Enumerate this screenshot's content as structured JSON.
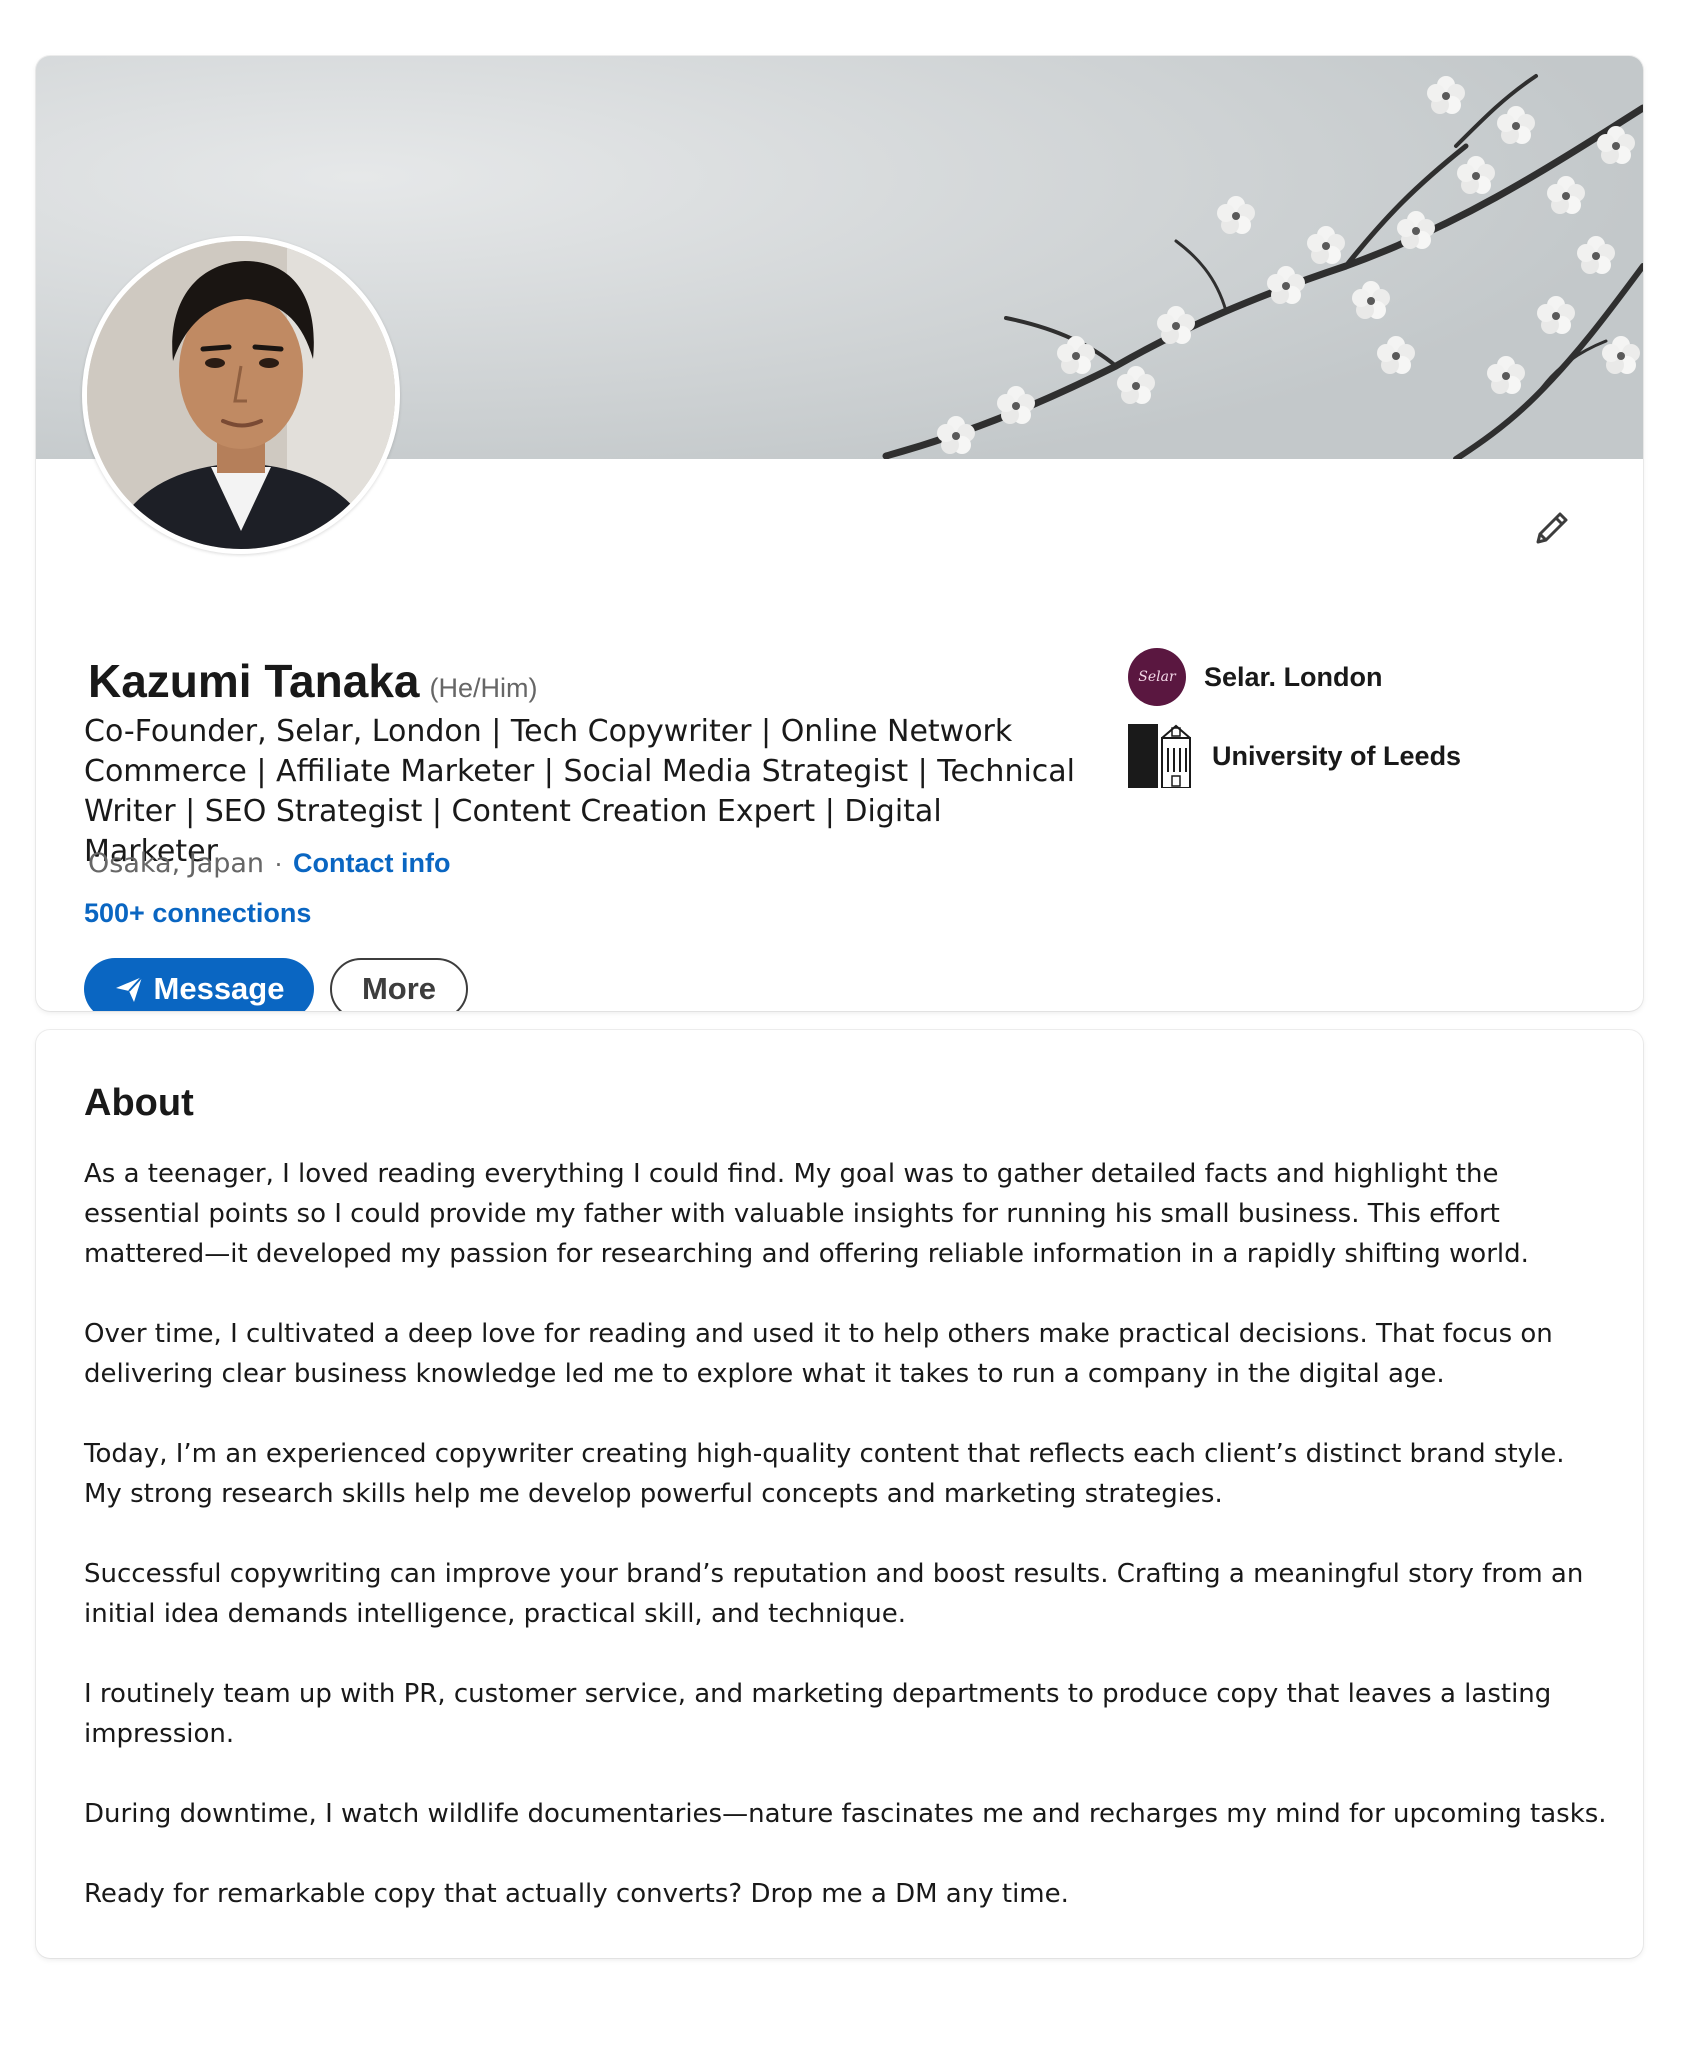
{
  "profile": {
    "name": "Kazumi Tanaka",
    "pronouns": "(He/Him)",
    "headline": "Co-Founder, Selar, London | Tech Copywriter | Online Network Commerce | Affiliate Marketer | Social Media Strategist | Technical Writer | SEO Strategist | Content Creation Expert | Digital Marketer",
    "location": "Osaka, Japan",
    "separator": "·",
    "contact_info_label": "Contact info",
    "connections_label": "500+ connections",
    "message_button_label": "Message",
    "more_button_label": "More",
    "current_company": {
      "name": "Selar. London",
      "logo_text": "Selar",
      "logo_color": "#5a1740"
    },
    "education": {
      "name": "University of Leeds"
    },
    "icons": {
      "edit": "pencil-icon",
      "message": "send-icon"
    }
  },
  "about": {
    "title": "About",
    "paragraphs": [
      "As a teenager, I loved reading everything I could find. My goal was to gather detailed facts and highlight the essential points so I could provide my father with valuable insights for running his small business. This effort mattered—it developed my passion for researching and offering reliable information in a rapidly shifting world.",
      "Over time, I cultivated a deep love for reading and used it to help others make practical decisions. That focus on delivering clear business knowledge led me to explore what it takes to run a company in the digital age.",
      "Today, I’m an experienced copywriter creating high-quality content that reflects each client’s distinct brand style. My strong research skills help me develop powerful concepts and marketing strategies.",
      "Successful copywriting can improve your brand’s reputation and boost results. Crafting a meaningful story from an initial idea demands intelligence, practical skill, and technique.",
      "I routinely team up with PR, customer service, and marketing departments to produce copy that leaves a lasting impression.",
      "During downtime, I watch wildlife documentaries—nature fascinates me and recharges my mind for upcoming tasks.",
      "Ready for remarkable copy that actually converts? Drop me a DM any time."
    ]
  },
  "colors": {
    "accent": "#0a66c2",
    "text_primary": "#191919",
    "text_secondary": "#666666"
  }
}
